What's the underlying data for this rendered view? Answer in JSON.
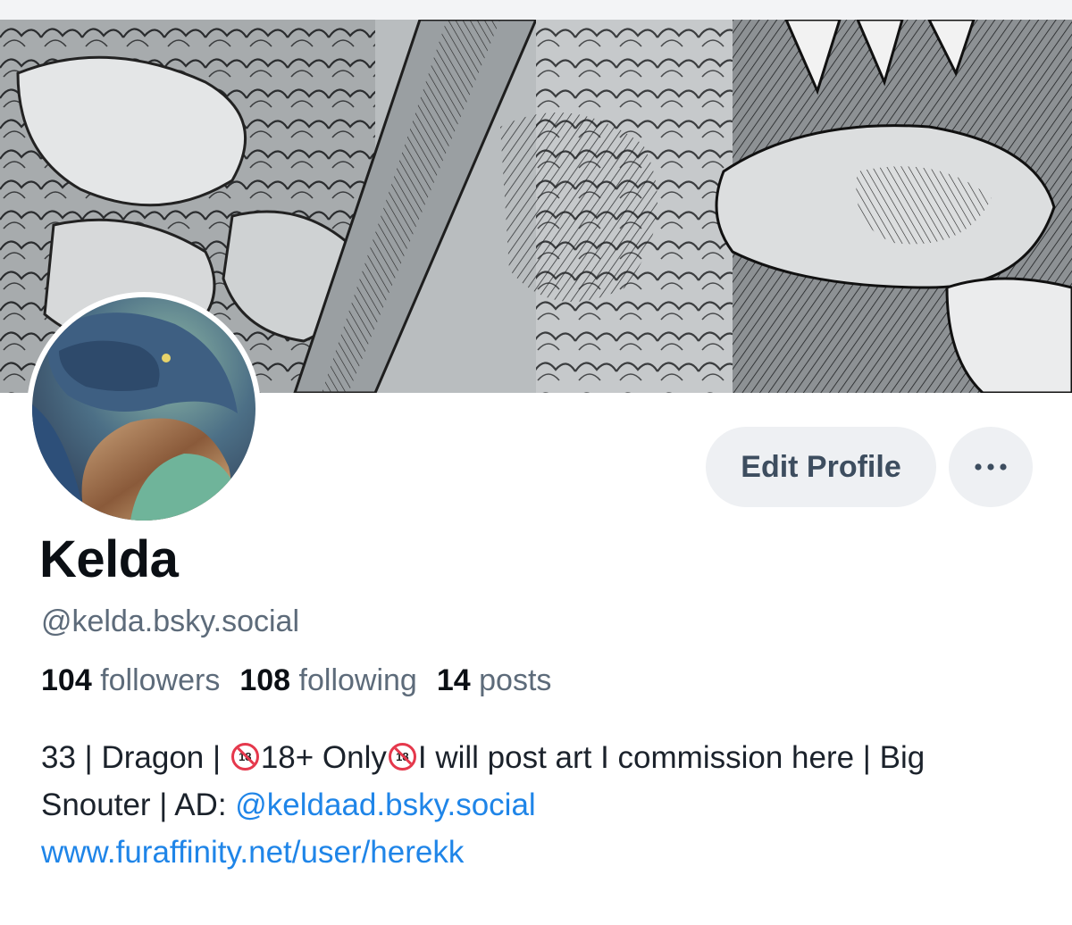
{
  "profile": {
    "display_name": "Kelda",
    "handle": "@kelda.bsky.social",
    "edit_button": "Edit Profile",
    "more_button": "…",
    "banner_icon": "dragon-artwork-banner",
    "avatar_icon": "dragon-avatar"
  },
  "stats": {
    "followers_count": "104",
    "followers_label": "followers",
    "following_count": "108",
    "following_label": "following",
    "posts_count": "14",
    "posts_label": "posts"
  },
  "bio": {
    "part1": "33 | Dragon | ",
    "badge": "18",
    "part2": "18+ Only",
    "part3": "I will post art I commission here | Big Snouter | AD: ",
    "ad_link": "@keldaad.bsky.social",
    "website": "www.furaffinity.net/user/herekk"
  },
  "colors": {
    "accent_link": "#1f85e8",
    "button_bg": "#eef0f3",
    "muted_text": "#5d6b7a",
    "badge_red": "#e5384c"
  }
}
